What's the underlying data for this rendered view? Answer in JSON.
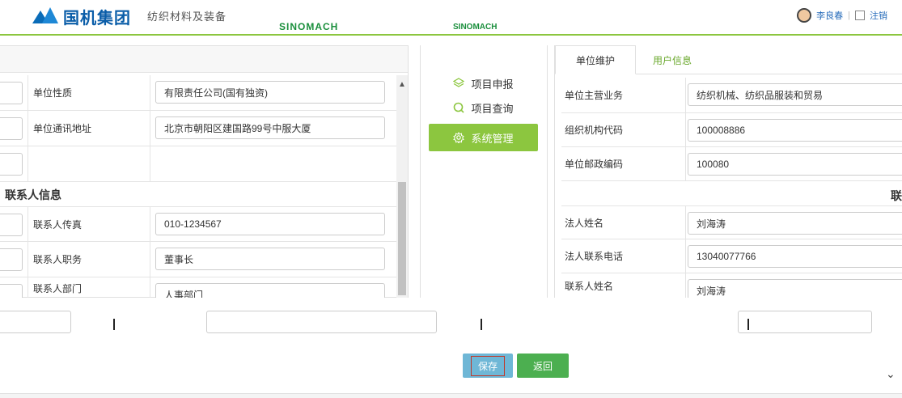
{
  "header": {
    "logo_text": "国机集团",
    "logo_subtitle": "纺织材料及装备",
    "logo_en": "SINOMACH",
    "logo_en2": "SINOMACH",
    "user_name": "李良春",
    "logout_label": "注销"
  },
  "left_form": {
    "rows": [
      {
        "label": "单位性质",
        "value": "有限责任公司(国有独资)"
      },
      {
        "label": "单位通讯地址",
        "value": "北京市朝阳区建国路99号中服大厦"
      },
      {
        "label": "",
        "value": ""
      }
    ],
    "section_title": "联系人信息",
    "contact_rows": [
      {
        "label": "联系人传真",
        "value": "010-1234567"
      },
      {
        "label": "联系人职务",
        "value": "董事长"
      },
      {
        "label": "联系人部门",
        "value": "人事部门"
      }
    ]
  },
  "nav": {
    "items": [
      {
        "label": "项目申报",
        "icon": "layers-icon"
      },
      {
        "label": "项目查询",
        "icon": "search-icon"
      },
      {
        "label": "系统管理",
        "icon": "gear-icon",
        "active": true
      }
    ]
  },
  "right_panel": {
    "tabs": [
      {
        "label": "单位维护",
        "active": true
      },
      {
        "label": "用户信息",
        "active": false
      }
    ],
    "rows": [
      {
        "label": "单位主营业务",
        "value": "纺织机械、纺织品服装和贸易"
      },
      {
        "label": "组织机构代码",
        "value": "100008886"
      },
      {
        "label": "单位邮政编码",
        "value": "100080"
      }
    ],
    "section_title": "联",
    "legal_rows": [
      {
        "label": "法人姓名",
        "value": "刘海涛"
      },
      {
        "label": "法人联系电话",
        "value": "13040077766"
      },
      {
        "label": "联系人姓名",
        "value": "刘海涛"
      }
    ]
  },
  "buttons": {
    "save": "保存",
    "back": "返回"
  },
  "colors": {
    "accent_green": "#8cc63f",
    "save_blue": "#6fb7d6",
    "back_green": "#4caf50"
  }
}
